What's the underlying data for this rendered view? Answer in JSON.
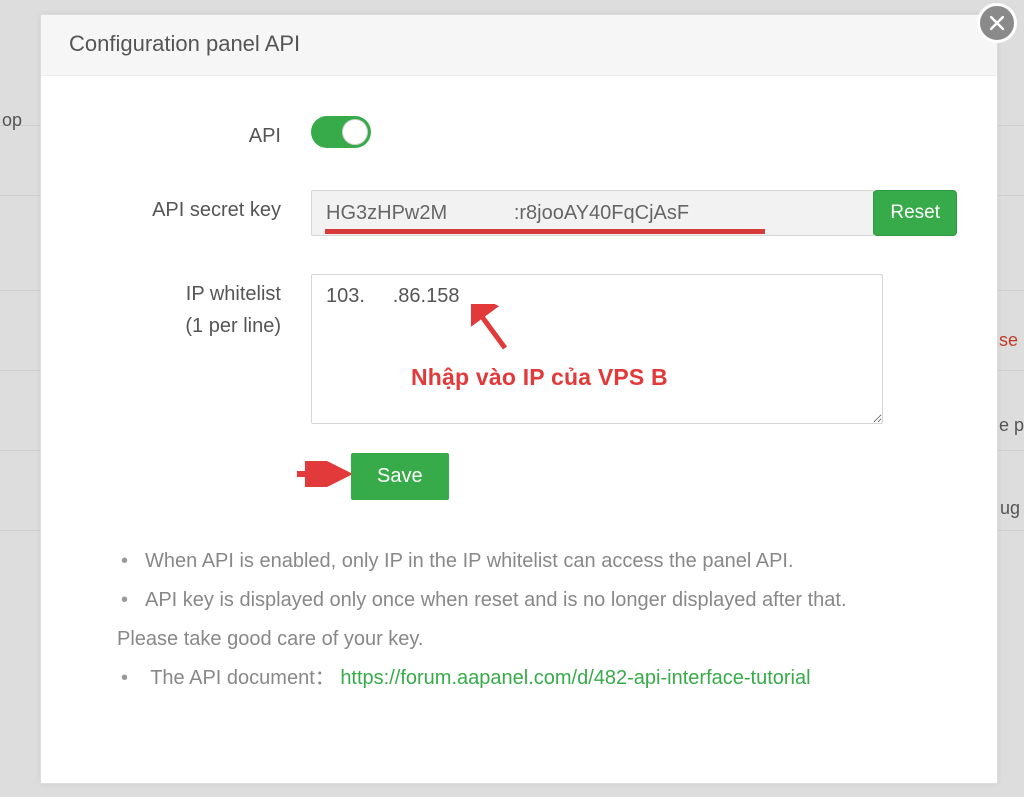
{
  "modal": {
    "title": "Configuration panel API",
    "fields": {
      "api_label": "API",
      "secret_label": "API secret key",
      "secret_value": "HG3zHPw2M            :r8jooAY40FqCjAsF",
      "reset_label": "Reset",
      "whitelist_label_line1": "IP whitelist",
      "whitelist_label_line2": "(1 per line)",
      "whitelist_value": "103.     .86.158",
      "save_label": "Save",
      "api_enabled": true
    },
    "annotations": {
      "ip_hint": "Nhập vào IP của VPS B"
    },
    "notes": {
      "n1": "When API is enabled, only IP in the IP whitelist can access the panel API.",
      "n2": "API key is displayed only once when reset and is no longer displayed after that.",
      "n2b": "Please take good care of your key.",
      "n3_prefix": "The API document：",
      "n3_link": "https://forum.aapanel.com/d/482-api-interface-tutorial"
    }
  },
  "background": {
    "left_text": "ор",
    "right_text1": "se",
    "right_text2": "ne p",
    "right_text3": "ug"
  }
}
